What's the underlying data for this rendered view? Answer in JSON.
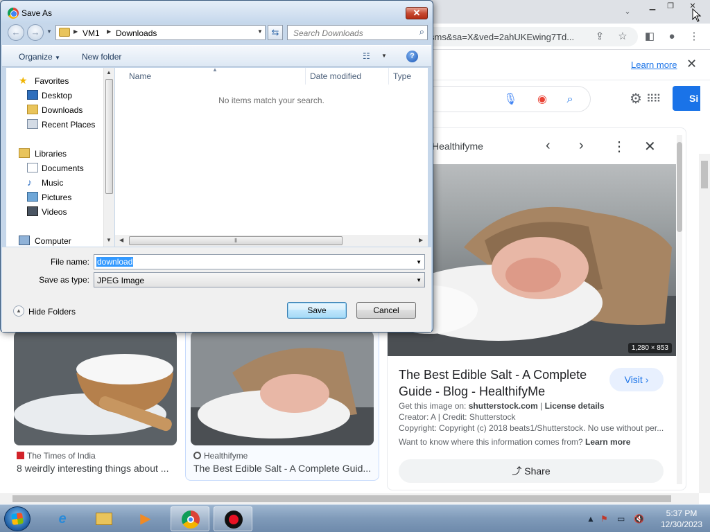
{
  "browser": {
    "omnibox_url": "sms&sa=X&ved=2ahUKEwing7Td...",
    "infobar": {
      "learn_more": "Learn more"
    },
    "signin_label": "Si"
  },
  "viewer": {
    "source": "Healthifyme",
    "image_size": "1,280 × 853",
    "title": "The Best Edible Salt - A Complete Guide - Blog - HealthifyMe",
    "visit_label": "Visit",
    "get_image_prefix": "Get this image on:",
    "get_image_site": "shutterstock.com",
    "license": "License details",
    "creator": "Creator: A | Credit: Shutterstock",
    "copyright": "Copyright: Copyright (c) 2018 beats1/Shutterstock. No use without per...",
    "want_to_know": "Want to know where this information comes from?",
    "learn_more": "Learn more",
    "share_label": "Share"
  },
  "cards": [
    {
      "source": "The Times of India",
      "title": "8 weirdly interesting things about ..."
    },
    {
      "source": "Healthifyme",
      "title": "The Best Edible Salt - A Complete Guid..."
    }
  ],
  "dialog": {
    "title": "Save As",
    "breadcrumb": [
      "VM1",
      "Downloads"
    ],
    "search_placeholder": "Search Downloads",
    "toolbar": {
      "organize": "Organize",
      "new_folder": "New folder"
    },
    "nav": {
      "favorites": "Favorites",
      "favorites_items": [
        "Desktop",
        "Downloads",
        "Recent Places"
      ],
      "libraries": "Libraries",
      "libraries_items": [
        "Documents",
        "Music",
        "Pictures",
        "Videos"
      ],
      "computer": "Computer"
    },
    "columns": [
      "Name",
      "Date modified",
      "Type"
    ],
    "empty_message": "No items match your search.",
    "file_name_label": "File name:",
    "file_name_value": "download",
    "save_type_label": "Save as type:",
    "save_type_value": "JPEG Image",
    "hide_folders": "Hide Folders",
    "save_button": "Save",
    "cancel_button": "Cancel"
  },
  "taskbar": {
    "apps": [
      "internet-explorer",
      "windows-explorer",
      "media-player",
      "chrome",
      "screen-recorder"
    ],
    "clock_time": "5:37 PM",
    "clock_date": "12/30/2023"
  }
}
